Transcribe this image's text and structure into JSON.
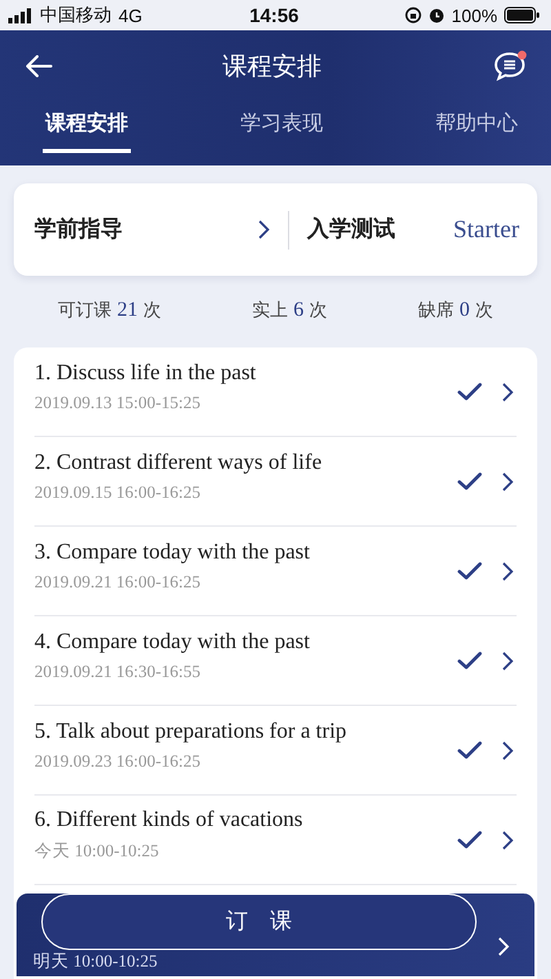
{
  "status_bar": {
    "carrier": "中国移动",
    "network": "4G",
    "time": "14:56",
    "battery": "100%"
  },
  "header": {
    "title": "课程安排",
    "unread": true
  },
  "tabs": [
    {
      "label": "课程安排",
      "selected": true
    },
    {
      "label": "学习表现",
      "selected": false
    },
    {
      "label": "帮助中心",
      "selected": false
    }
  ],
  "summary_card": {
    "guide": "学前指导",
    "test_label": "入学测试",
    "test_level": "Starter"
  },
  "stats": [
    {
      "label": "可订课",
      "value": "21",
      "unit": "次"
    },
    {
      "label": "实上",
      "value": "6",
      "unit": "次"
    },
    {
      "label": "缺席",
      "value": "0",
      "unit": "次"
    }
  ],
  "lessons": [
    {
      "title": "1. Discuss life in the past",
      "time": "2019.09.13 15:00-15:25",
      "checked": true,
      "selected": false
    },
    {
      "title": "2. Contrast different ways of life",
      "time": "2019.09.15 16:00-16:25",
      "checked": true,
      "selected": false
    },
    {
      "title": "3. Compare today with the past",
      "time": "2019.09.21 16:00-16:25",
      "checked": true,
      "selected": false
    },
    {
      "title": "4. Compare today with the past",
      "time": "2019.09.21 16:30-16:55",
      "checked": true,
      "selected": false
    },
    {
      "title": "5. Talk about preparations for a trip",
      "time": "2019.09.23 16:00-16:25",
      "checked": true,
      "selected": false
    },
    {
      "title": "6. Different kinds of vacations",
      "time": "今天 10:00-10:25",
      "checked": true,
      "selected": false
    },
    {
      "time": "明天 10:00-10:25",
      "checked": false,
      "selected": true
    }
  ],
  "book_button": "订　课"
}
